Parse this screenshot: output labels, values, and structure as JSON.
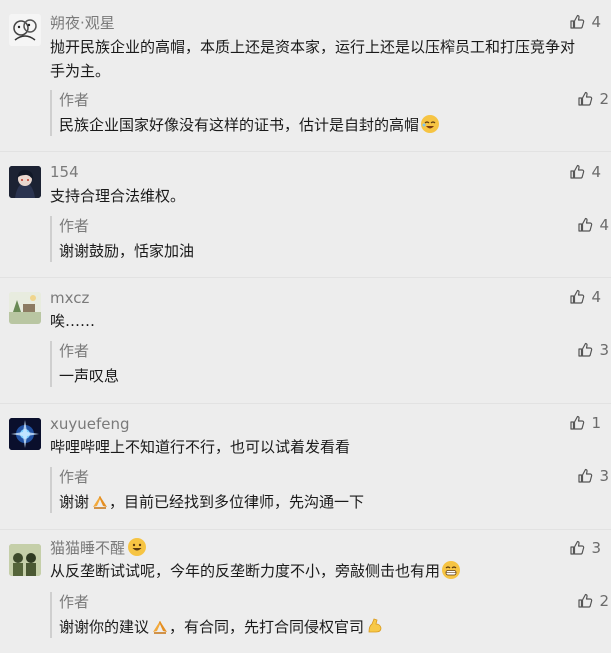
{
  "comments": [
    {
      "name": "朔夜·观星",
      "text": "抛开民族企业的高帽，本质上还是资本家，运行上还是以压榨员工和打压竞争对手为主。",
      "likes": "4",
      "reply": {
        "author": "作者",
        "text": "民族企业国家好像没有这样的证书，估计是自封的高帽",
        "likes": "2"
      }
    },
    {
      "name": "154",
      "text": "支持合理合法维权。",
      "likes": "4",
      "reply": {
        "author": "作者",
        "text": "谢谢鼓励，恬家加油",
        "likes": "4"
      }
    },
    {
      "name": "mxcz",
      "text": "唉……",
      "likes": "4",
      "reply": {
        "author": "作者",
        "text": "一声叹息",
        "likes": "3"
      }
    },
    {
      "name": "xuyuefeng",
      "text": "哔哩哔哩上不知道行不行，也可以试着发看看",
      "likes": "1",
      "reply": {
        "author": "作者",
        "text_a": "谢谢",
        "text_b": "，目前已经找到多位律师，先沟通一下",
        "likes": "3"
      }
    },
    {
      "name": "猫猫睡不醒",
      "text": "从反垄断试试呢，今年的反垄断力度不小，旁敲侧击也有用",
      "likes": "3",
      "reply": {
        "author": "作者",
        "text_a": "谢谢你的建议",
        "text_b": "，有合同，先打合同侵权官司",
        "likes": "2"
      }
    }
  ],
  "icons": {
    "like": "thumbs-up-icon",
    "emoji_laugh": "laughing-emoji-icon",
    "emoji_pray": "praying-hands-emoji-icon",
    "emoji_grin": "grinning-emoji-icon",
    "emoji_muscle": "flexed-biceps-emoji-icon"
  },
  "colors": {
    "background": "#ededed",
    "name": "#7a7a7a",
    "text": "#1a1a1a",
    "reply_bar": "#cfcfcf"
  }
}
